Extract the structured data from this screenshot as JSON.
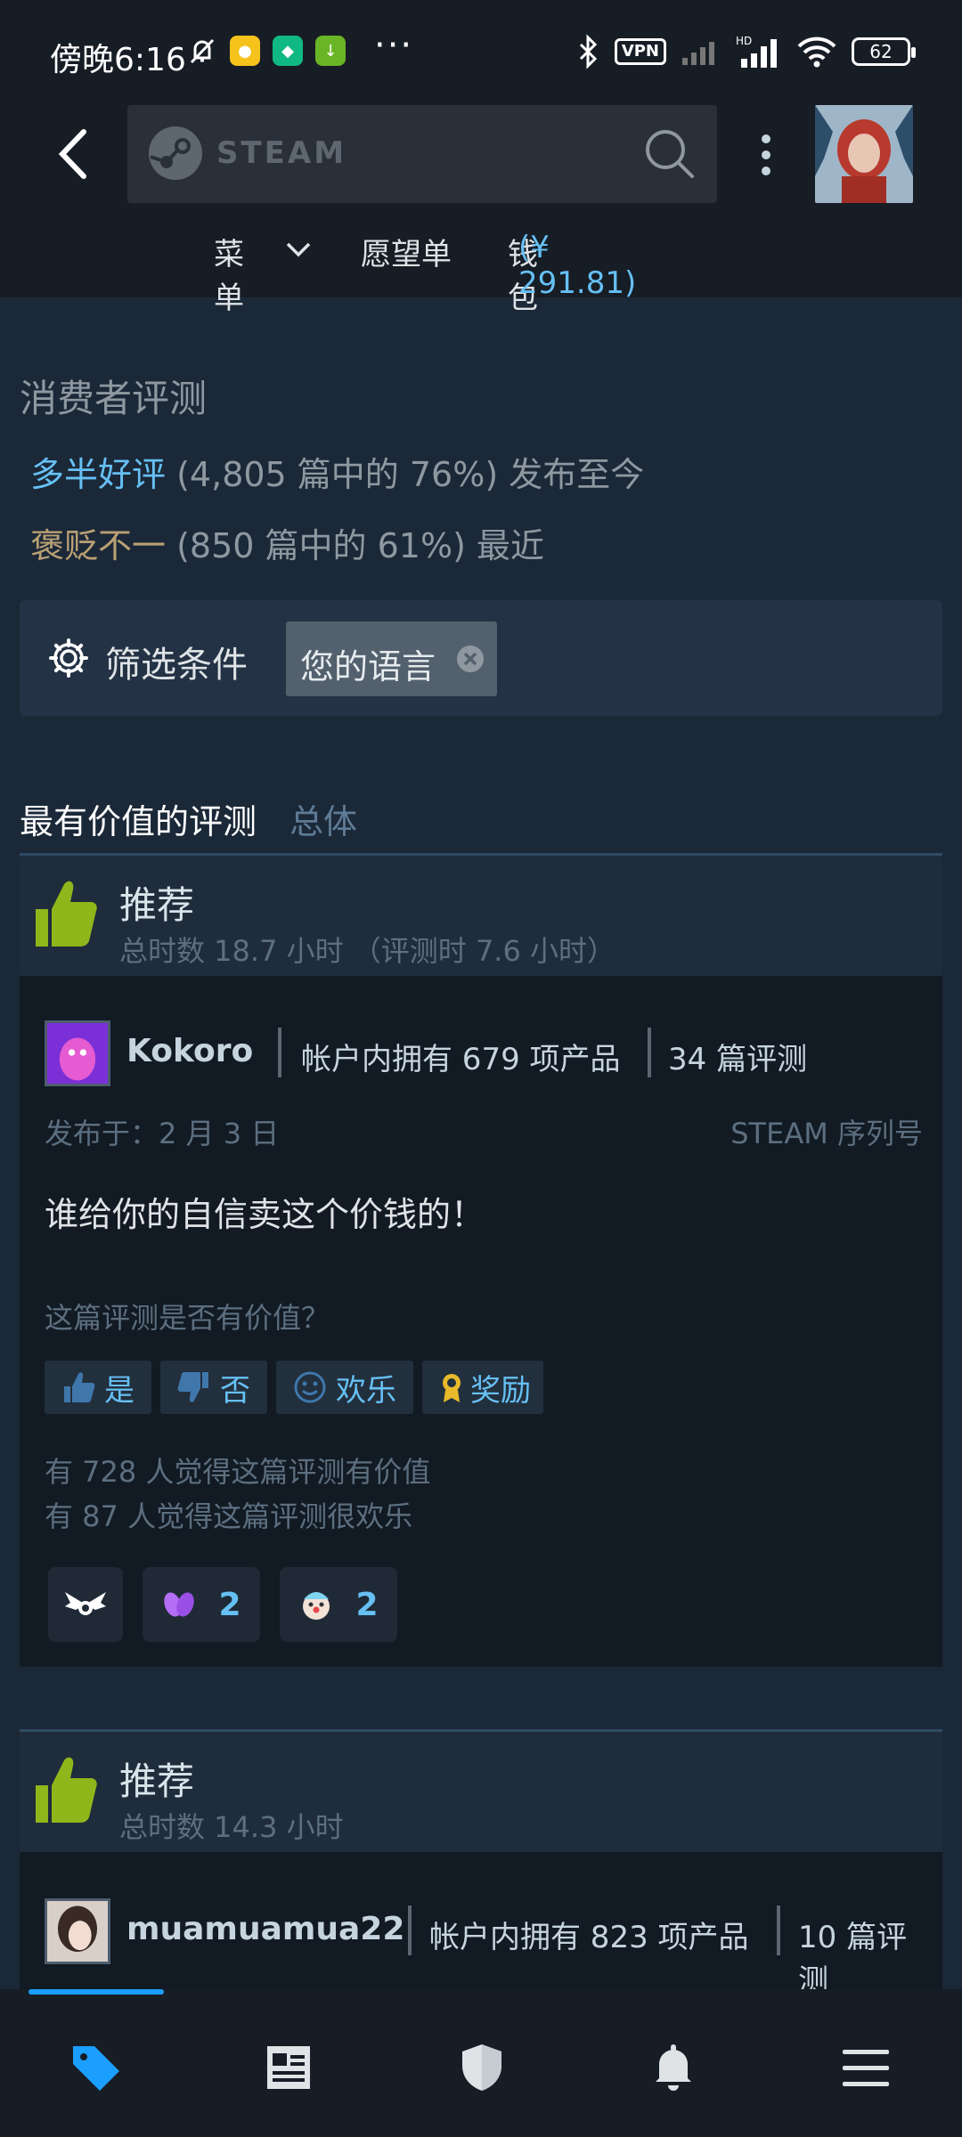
{
  "status_bar": {
    "time": "傍晚6:16",
    "more_dots": "···",
    "vpn_label": "VPN",
    "battery": "62"
  },
  "navbar": {
    "search_placeholder": "STEAM",
    "submenu": {
      "menu_label": "菜单",
      "wishlist_label": "愿望单",
      "wallet_label": "钱包",
      "wallet_balance": "(¥ 291.81)"
    }
  },
  "consumer_reviews": {
    "title": "消费者评测",
    "overall": {
      "rating": "多半好评",
      "detail": "(4,805 篇中的 76%) 发布至今"
    },
    "recent": {
      "rating": "褒贬不一",
      "detail": "(850 篇中的 61%) 最近"
    }
  },
  "filter": {
    "label": "筛选条件",
    "chip": "您的语言"
  },
  "helpful_header": {
    "title": "最有价值的评测",
    "scope": "总体"
  },
  "reviews": [
    {
      "recommendation": "推荐",
      "hours": "总时数 18.7 小时 （评测时 7.6 小时）",
      "author": "Kokoro",
      "products": "帐户内拥有 679 项产品",
      "review_count": "34 篇评测",
      "posted": "发布于：2 月 3 日",
      "product_key": "STEAM 序列号",
      "text": "谁给你的自信卖这个价钱的！",
      "helpful_question": "这篇评测是否有价值？",
      "buttons": {
        "yes": "是",
        "no": "否",
        "funny": "欢乐",
        "award": "奖励"
      },
      "helpful_count_text": "有 728 人觉得这篇评测有价值",
      "funny_count_text": "有 87 人觉得这篇评测很欢乐",
      "awards": [
        {
          "icon": "winged-award-icon",
          "count": ""
        },
        {
          "icon": "purple-hands-award-icon",
          "count": "2"
        },
        {
          "icon": "clown-face-award-icon",
          "count": "2"
        }
      ]
    },
    {
      "recommendation": "推荐",
      "hours": "总时数 14.3 小时",
      "author": "muamuamua22",
      "products": "帐户内拥有 823 项产品",
      "review_count": "10 篇评测"
    }
  ],
  "colors": {
    "background": "#1b2838",
    "accent_blue": "#66c0f4",
    "mixed_rating": "#b9a074",
    "thumb_green": "#8fb61b"
  }
}
